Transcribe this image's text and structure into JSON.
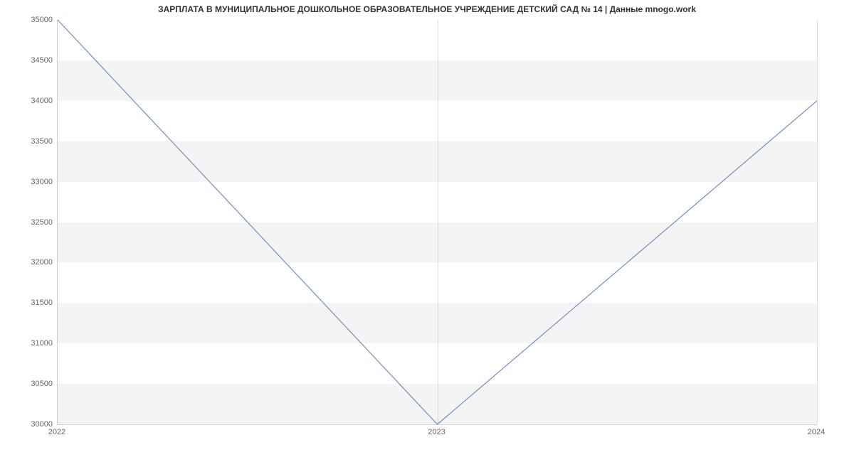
{
  "chart_data": {
    "type": "line",
    "title": "ЗАРПЛАТА В МУНИЦИПАЛЬНОЕ ДОШКОЛЬНОЕ ОБРАЗОВАТЕЛЬНОЕ УЧРЕЖДЕНИЕ ДЕТСКИЙ САД № 14 | Данные mnogo.work",
    "xlabel": "",
    "ylabel": "",
    "x": [
      2022,
      2023,
      2024
    ],
    "values": [
      35000,
      30000,
      34000
    ],
    "x_ticks": [
      "2022",
      "2023",
      "2024"
    ],
    "y_ticks": [
      30000,
      30500,
      31000,
      31500,
      32000,
      32500,
      33000,
      33500,
      34000,
      34500,
      35000
    ],
    "xlim": [
      2022,
      2024
    ],
    "ylim": [
      30000,
      35000
    ],
    "grid": {
      "x": true,
      "y_bands": true
    },
    "color": "#6f8fc8"
  }
}
